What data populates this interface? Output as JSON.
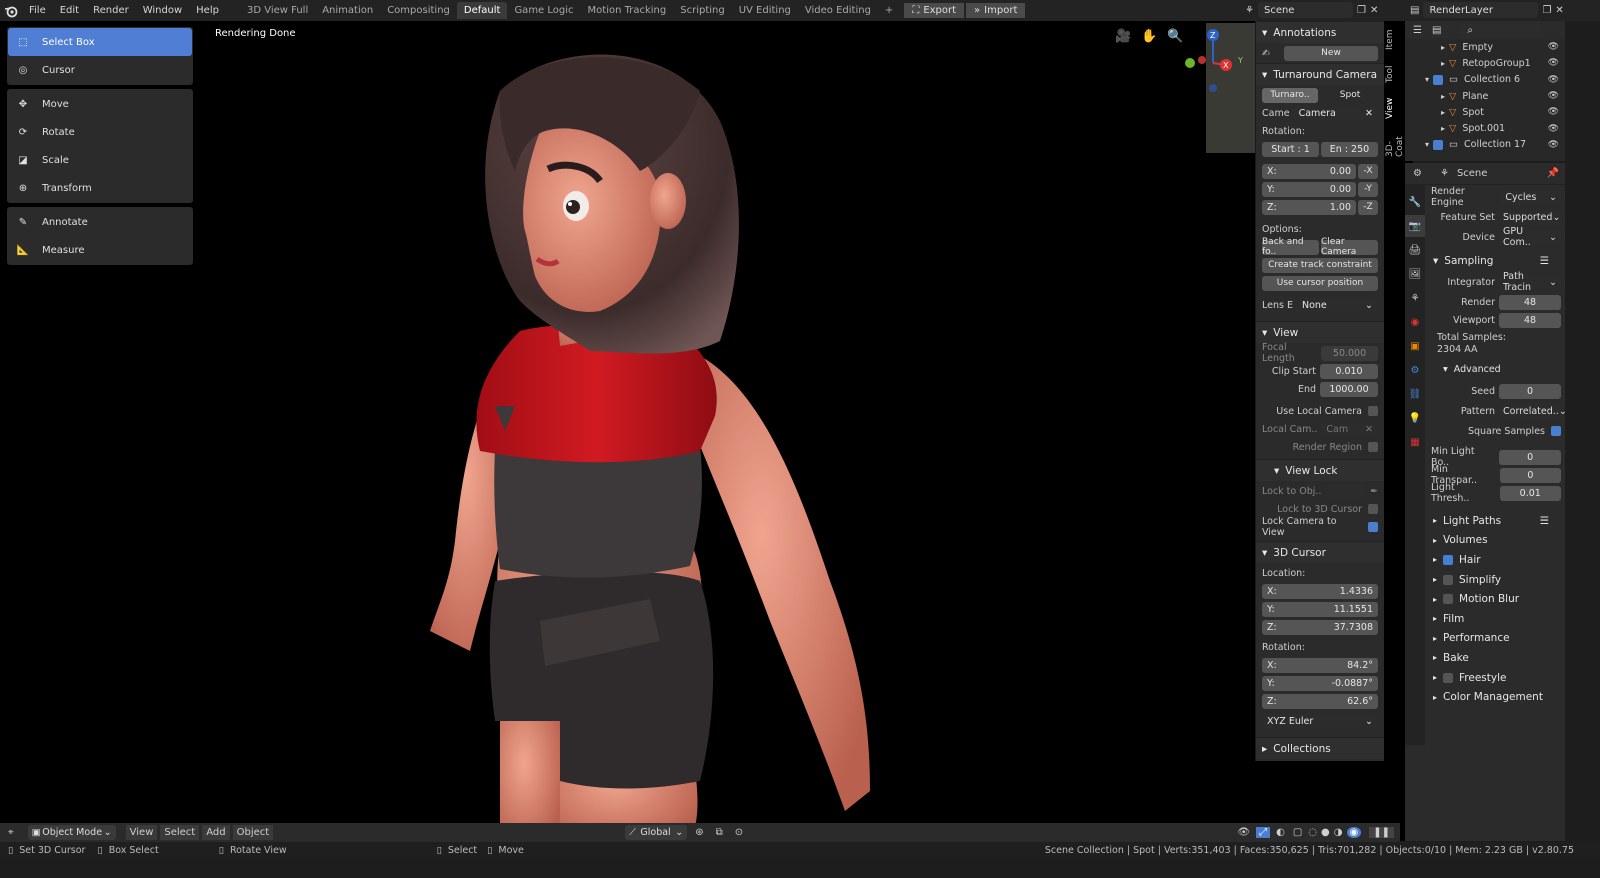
{
  "menu": [
    "File",
    "Edit",
    "Render",
    "Window",
    "Help"
  ],
  "workspaces": [
    "3D View Full",
    "Animation",
    "Compositing",
    "Default",
    "Game Logic",
    "Motion Tracking",
    "Scripting",
    "UV Editing",
    "Video Editing"
  ],
  "active_workspace": "Default",
  "addon_buttons": {
    "export": "Export",
    "import": "Import"
  },
  "scene_field": "Scene",
  "layer_field": "RenderLayer",
  "viewport": {
    "status": "Rendering Done"
  },
  "tools": [
    {
      "label": "Select Box",
      "icon": "select-box-icon",
      "active": true
    },
    {
      "label": "Cursor",
      "icon": "cursor-icon",
      "active": false
    },
    {
      "label": "Move",
      "icon": "move-icon",
      "active": false
    },
    {
      "label": "Rotate",
      "icon": "rotate-icon",
      "active": false
    },
    {
      "label": "Scale",
      "icon": "scale-icon",
      "active": false
    },
    {
      "label": "Transform",
      "icon": "transform-icon",
      "active": false
    },
    {
      "label": "Annotate",
      "icon": "annotate-icon",
      "active": false
    },
    {
      "label": "Measure",
      "icon": "measure-icon",
      "active": false
    }
  ],
  "sidetabs": [
    "Item",
    "Tool",
    "View",
    "3D-Coat"
  ],
  "npanel": {
    "annotations": {
      "header": "Annotations",
      "new": "New"
    },
    "turnaround": {
      "header": "Turnaround Camera",
      "btn1": "Turnaro..",
      "btn2": "Spot",
      "came_label": "Came",
      "came_value": "Camera",
      "rotation_label": "Rotation:",
      "start": "Start : 1",
      "end": "En : 250",
      "x_label": "X:",
      "x_value": "0.00",
      "x_neg": "-X",
      "y_label": "Y:",
      "y_value": "0.00",
      "y_neg": "-Y",
      "z_label": "Z:",
      "z_value": "1.00",
      "z_neg": "-Z",
      "options_label": "Options:",
      "back_forth": "Back and fo..",
      "clear_camera": "Clear Camera",
      "create_track": "Create track constraint",
      "use_cursor": "Use cursor position",
      "lens_label": "Lens E",
      "lens_value": "None"
    },
    "view": {
      "header": "View",
      "focal_label": "Focal Length",
      "focal_value": "50.000",
      "clip_start_label": "Clip Start",
      "clip_start_value": "0.010",
      "end_label": "End",
      "end_value": "1000.00",
      "use_local": "Use Local Camera",
      "local_cam_label": "Local Cam..",
      "local_cam_value": "Cam",
      "render_region": "Render Region"
    },
    "view_lock": {
      "header": "View Lock",
      "lock_obj": "Lock to Obj..",
      "lock_cursor": "Lock to 3D Cursor",
      "lock_camera": "Lock Camera to View"
    },
    "cursor": {
      "header": "3D Cursor",
      "location_label": "Location:",
      "x_label": "X:",
      "x": "1.4336",
      "y_label": "Y:",
      "y": "11.1551",
      "z_label": "Z:",
      "z": "37.7308",
      "rotation_label": "Rotation:",
      "rx_label": "X:",
      "rx": "84.2°",
      "ry_label": "Y:",
      "ry": "-0.0887°",
      "rz_label": "Z:",
      "rz": "62.6°",
      "mode": "XYZ Euler"
    },
    "collections": {
      "header": "Collections"
    }
  },
  "outliner": [
    {
      "name": "Empty",
      "indent": 2
    },
    {
      "name": "RetopoGroup1",
      "indent": 2
    },
    {
      "name": "Collection 6",
      "indent": 1
    },
    {
      "name": "Plane",
      "indent": 2
    },
    {
      "name": "Spot",
      "indent": 2
    },
    {
      "name": "Spot.001",
      "indent": 2
    },
    {
      "name": "Collection 17",
      "indent": 1
    }
  ],
  "props": {
    "scene_label": "Scene",
    "render_engine_label": "Render Engine",
    "render_engine": "Cycles",
    "feature_set_label": "Feature Set",
    "feature_set": "Supported",
    "device_label": "Device",
    "device": "GPU Com..",
    "sampling": "Sampling",
    "integrator_label": "Integrator",
    "integrator": "Path Tracin",
    "render_label": "Render",
    "render": "48",
    "viewport_label": "Viewport",
    "viewport": "48",
    "total_samples_label": "Total Samples:",
    "total_samples": "2304 AA",
    "advanced": "Advanced",
    "seed_label": "Seed",
    "seed": "0",
    "pattern_label": "Pattern",
    "pattern": "Correlated..",
    "square_samples": "Square Samples",
    "min_light_label": "Min Light Bo..",
    "min_light": "0",
    "min_transp_label": "Min Transpar..",
    "min_transp": "0",
    "light_thresh_label": "Light Thresh..",
    "light_thresh": "0.01",
    "sections": [
      {
        "label": "Light Paths",
        "check": false
      },
      {
        "label": "Volumes",
        "check": false
      },
      {
        "label": "Hair",
        "check": true
      },
      {
        "label": "Simplify",
        "check": "off"
      },
      {
        "label": "Motion Blur",
        "check": "off"
      },
      {
        "label": "Film",
        "check": false
      },
      {
        "label": "Performance",
        "check": false
      },
      {
        "label": "Bake",
        "check": false
      },
      {
        "label": "Freestyle",
        "check": "off"
      },
      {
        "label": "Color Management",
        "check": false
      }
    ]
  },
  "header3d": {
    "mode": "Object Mode",
    "view": "View",
    "select": "Select",
    "add": "Add",
    "object": "Object",
    "transform": "Global"
  },
  "status": {
    "set_cursor": "Set 3D Cursor",
    "box_select": "Box Select",
    "rotate_view": "Rotate View",
    "select": "Select",
    "move": "Move",
    "info": "Scene Collection | Spot | Verts:351,403 | Faces:350,625 | Tris:701,282 | Objects:0/10 | Mem: 2.23 GB | v2.80.75"
  },
  "colors": {
    "accent": "#4f7ed4",
    "shirt": "#c0131d",
    "shorts": "#2f2a2b",
    "skin": "#e79581",
    "hair": "#4a3534"
  }
}
